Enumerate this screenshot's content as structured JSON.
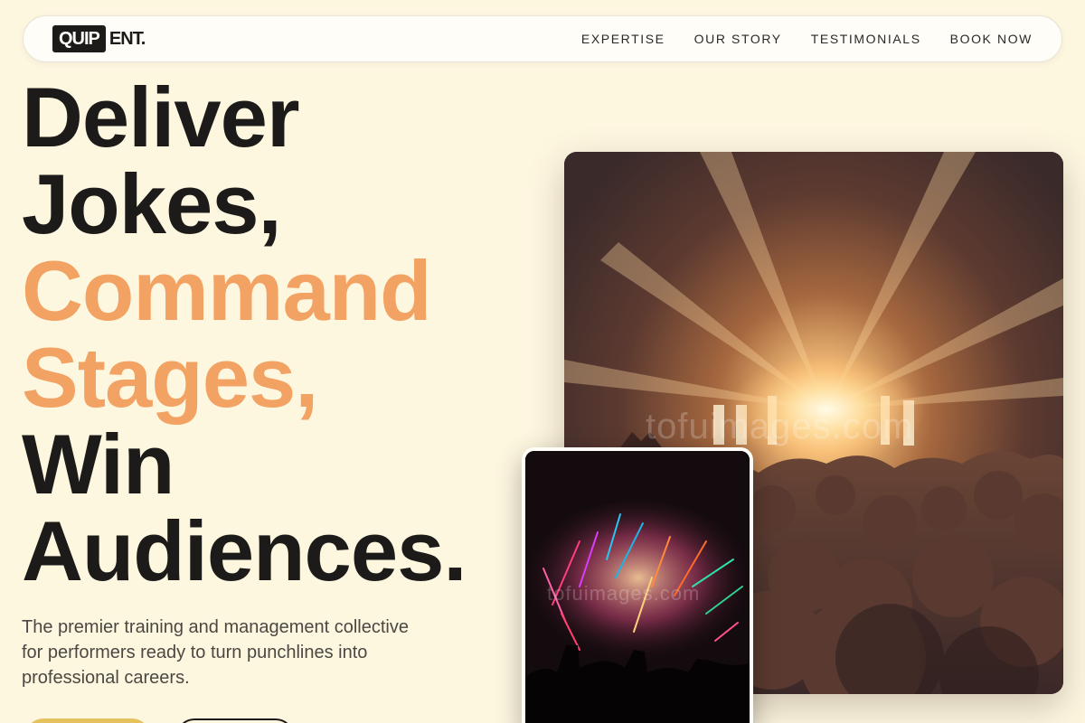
{
  "brand": {
    "logo_box": "QUIP",
    "logo_rest": "ENT."
  },
  "nav": {
    "items": [
      "EXPERTISE",
      "OUR STORY",
      "TESTIMONIALS",
      "BOOK NOW"
    ]
  },
  "hero": {
    "lines": [
      {
        "text": "Deliver",
        "accent": false
      },
      {
        "text": "Jokes,",
        "accent": false
      },
      {
        "text": "Command",
        "accent": true
      },
      {
        "text": "Stages,",
        "accent": true
      },
      {
        "text": "Win",
        "accent": false
      },
      {
        "text": "Audiences.",
        "accent": false
      }
    ],
    "lede": "The premier training and management collective for performers ready to turn punchlines into professional careers."
  },
  "images": {
    "main_alt": "Concert crowd facing a brightly lit stage",
    "small_alt": "Fireworks above a crowd at night",
    "watermark": "tofuimages.com"
  },
  "colors": {
    "background": "#fef7e0",
    "accent": "#f2a263",
    "cta": "#e6c25f",
    "ink": "#1c1b1a"
  }
}
